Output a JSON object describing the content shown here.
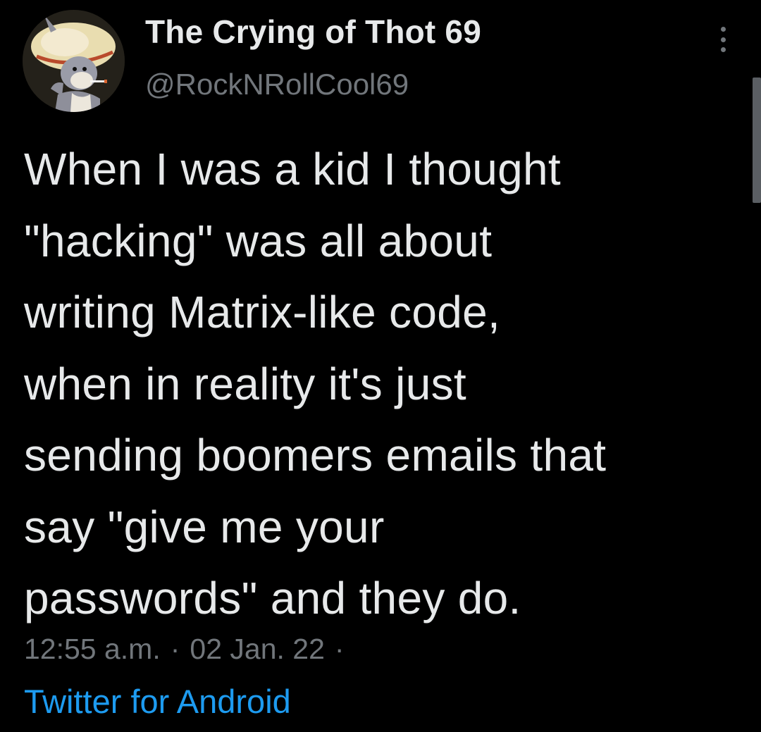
{
  "tweet": {
    "author": {
      "display_name": "The Crying of Thot 69",
      "handle": "@RockNRollCool69",
      "avatar_icon": "bugs-bunny-avatar"
    },
    "more_icon": "more-vertical-icon",
    "text": "When I was a kid I thought\n\"hacking\" was all about\nwriting Matrix-like code,\nwhen in reality it's just\nsending boomers emails that\nsay \"give me your\npasswords\" and they do.",
    "time": "12:55 a.m.",
    "date": "02 Jan. 22",
    "separator": "·",
    "source": "Twitter for Android"
  },
  "colors": {
    "background": "#000000",
    "text_primary": "#e7e9ea",
    "text_secondary": "#71767b",
    "link": "#1d9bf0"
  }
}
